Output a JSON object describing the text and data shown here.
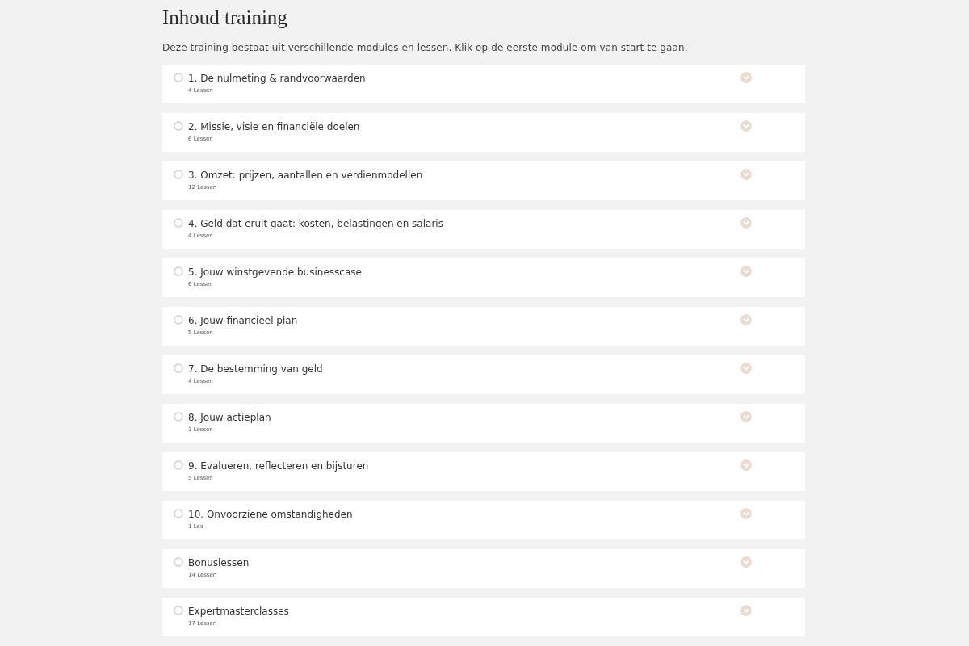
{
  "title": "Inhoud training",
  "intro": "Deze training bestaat uit verschillende modules en lessen. Klik op de eerste module om van start te gaan.",
  "modules": [
    {
      "title": "1. De nulmeting & randvoorwaarden",
      "lessons": "4 Lessen",
      "completed": false,
      "expanded": false
    },
    {
      "title": "2. Missie, visie en financiële doelen",
      "lessons": "6 Lessen",
      "completed": false,
      "expanded": false
    },
    {
      "title": "3. Omzet: prijzen, aantallen en verdienmodellen",
      "lessons": "12 Lessen",
      "completed": false,
      "expanded": false
    },
    {
      "title": "4. Geld dat eruit gaat: kosten, belastingen en salaris",
      "lessons": "4 Lessen",
      "completed": false,
      "expanded": false
    },
    {
      "title": "5. Jouw winstgevende businesscase",
      "lessons": "6 Lessen",
      "completed": false,
      "expanded": false
    },
    {
      "title": "6. Jouw financieel plan",
      "lessons": "5 Lessen",
      "completed": false,
      "expanded": false
    },
    {
      "title": "7. De bestemming van geld",
      "lessons": "4 Lessen",
      "completed": false,
      "expanded": false
    },
    {
      "title": "8. Jouw actieplan",
      "lessons": "3 Lessen",
      "completed": false,
      "expanded": false
    },
    {
      "title": "9. Evalueren, reflecteren en bijsturen",
      "lessons": "5 Lessen",
      "completed": false,
      "expanded": false
    },
    {
      "title": "10. Onvoorziene omstandigheden",
      "lessons": "1 Les",
      "completed": false,
      "expanded": false
    },
    {
      "title": "Bonuslessen",
      "lessons": "14 Lessen",
      "completed": false,
      "expanded": false
    },
    {
      "title": "Expertmasterclasses",
      "lessons": "17 Lessen",
      "completed": false,
      "expanded": false
    }
  ]
}
